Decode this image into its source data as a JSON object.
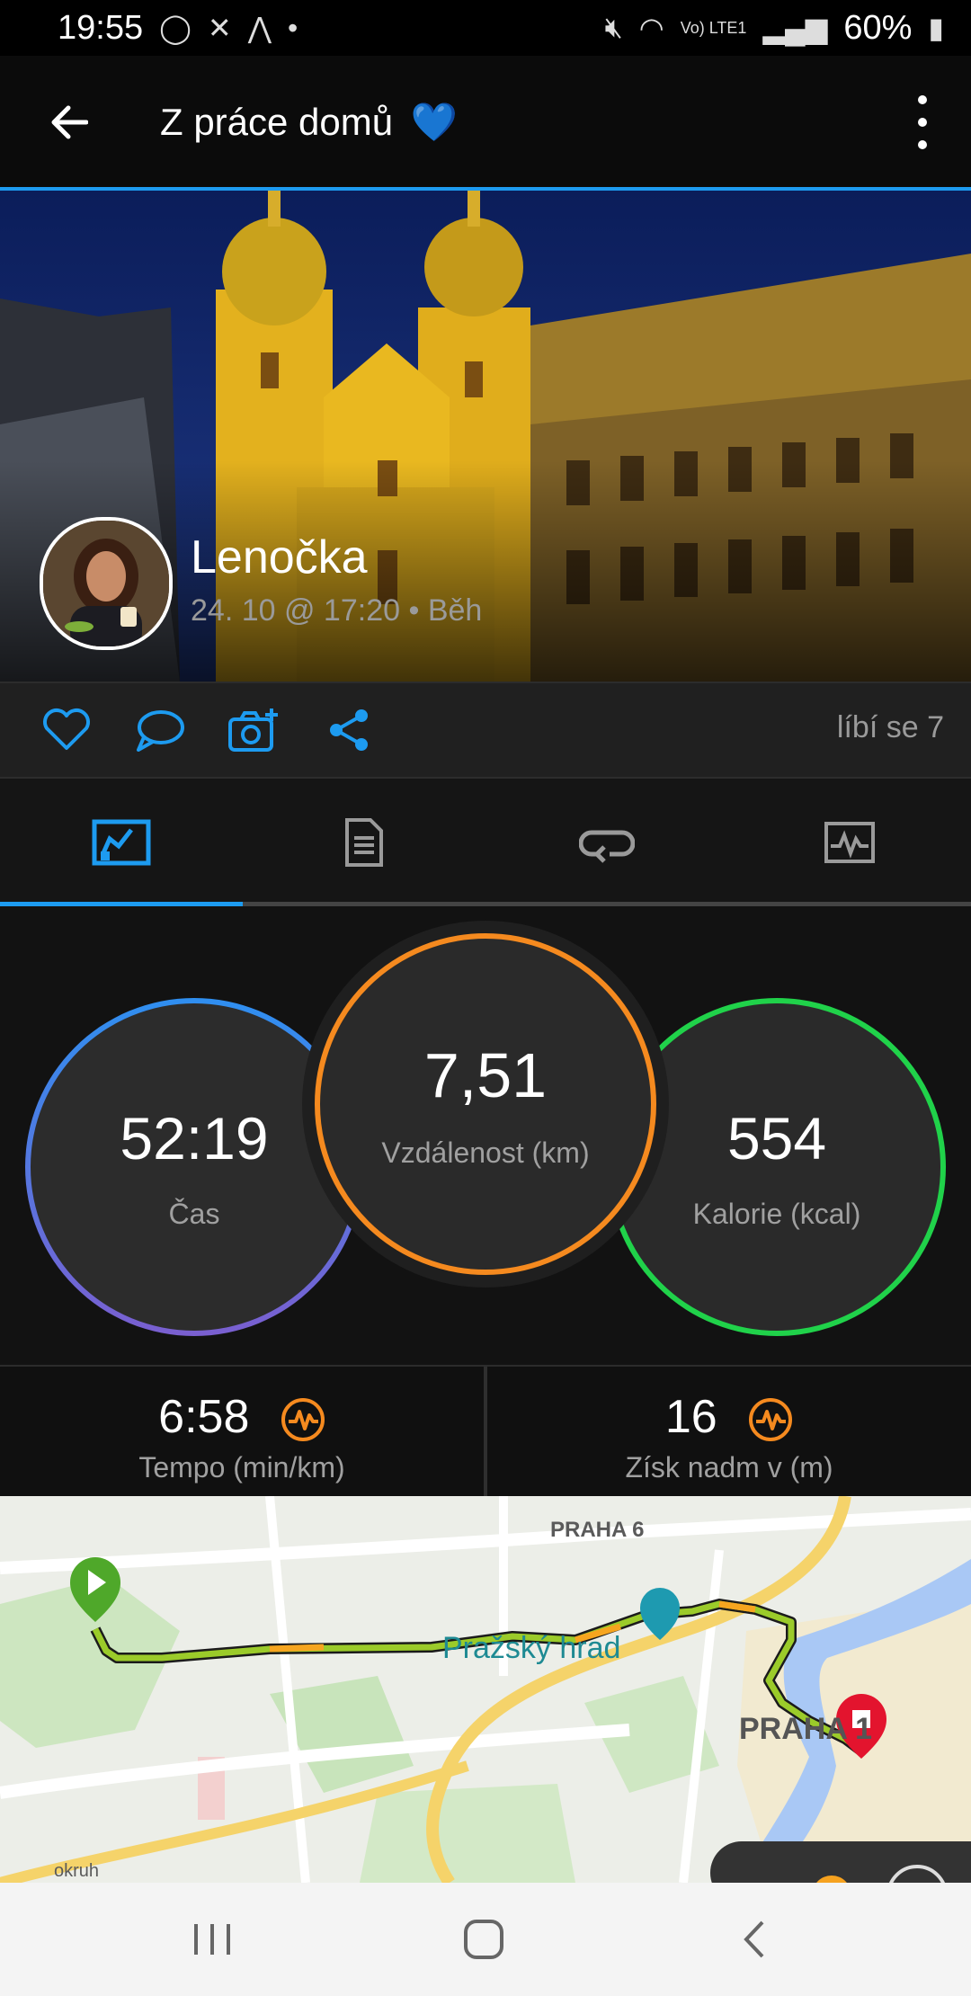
{
  "status": {
    "time": "19:55",
    "battery": "60%",
    "network": "Vo) LTE1"
  },
  "header": {
    "title": "Z práce domů",
    "title_emoji": "💙"
  },
  "profile": {
    "name": "Lenočka",
    "meta": "24. 10 @ 17:20 • Běh"
  },
  "social": {
    "likes": "líbí se 7"
  },
  "tabs": [
    {
      "name": "overview",
      "icon": "map-stats-icon",
      "active": true
    },
    {
      "name": "details",
      "icon": "document-icon"
    },
    {
      "name": "laps",
      "icon": "laps-icon"
    },
    {
      "name": "charts",
      "icon": "chart-icon"
    }
  ],
  "stats": {
    "time": {
      "value": "52:19",
      "label": "Čas"
    },
    "distance": {
      "value": "7,51",
      "label": "Vzdálenost (km)"
    },
    "calories": {
      "value": "554",
      "label": "Kalorie (kcal)"
    }
  },
  "substats": {
    "pace": {
      "value": "6:58",
      "label": "Tempo (min/km)"
    },
    "elevation": {
      "value": "16",
      "label": "Získ nadm v (m)"
    }
  },
  "map": {
    "labels": {
      "district_6": "PRAHA 6",
      "district_1": "PRAHA 1",
      "poi": "Pražský hrad",
      "road": "okruh"
    }
  },
  "colors": {
    "accent": "#1d9bf0",
    "distance": "#f58a1f",
    "calories": "#20d24a",
    "time_top": "#2f8ff0",
    "time_bottom": "#7a5fd0"
  }
}
